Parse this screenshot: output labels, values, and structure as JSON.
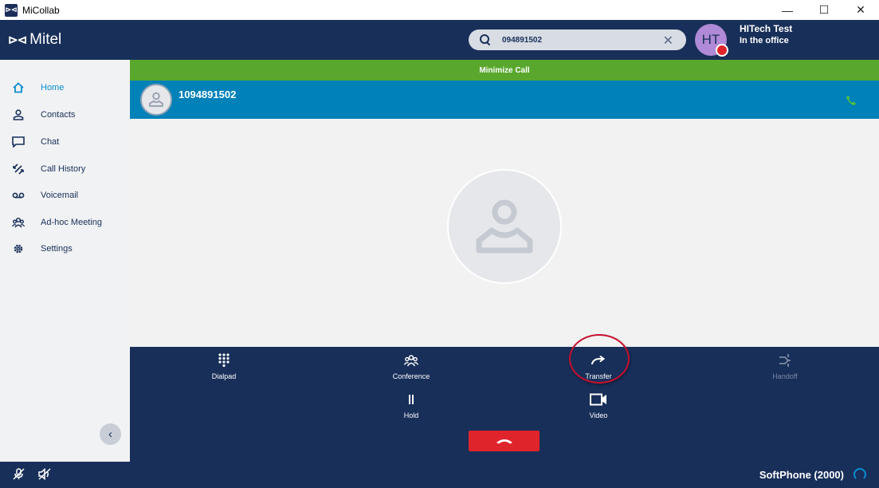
{
  "window": {
    "title": "MiCollab",
    "app_icon": "micollab-logo-icon",
    "controls": [
      "minimize-icon",
      "maximize-icon",
      "close-icon"
    ]
  },
  "header": {
    "logo_text": "Mitel",
    "search": {
      "value": "094891502",
      "placeholder": ""
    },
    "user": {
      "initials": "HT",
      "name": "HITech Test",
      "status": "In the office",
      "presence_color": "#e0242b"
    }
  },
  "sidebar": {
    "items": [
      {
        "label": "Home",
        "icon": "home-icon",
        "active": true
      },
      {
        "label": "Contacts",
        "icon": "contact-icon",
        "active": false
      },
      {
        "label": "Chat",
        "icon": "chat-icon",
        "active": false
      },
      {
        "label": "Call History",
        "icon": "call-history-icon",
        "active": false
      },
      {
        "label": "Voicemail",
        "icon": "voicemail-icon",
        "active": false
      },
      {
        "label": "Ad-hoc Meeting",
        "icon": "meeting-icon",
        "active": false
      },
      {
        "label": "Settings",
        "icon": "gear-icon",
        "active": false
      }
    ]
  },
  "call": {
    "minimize_label": "Minimize Call",
    "number": "1094891502",
    "controls": {
      "dialpad": "Dialpad",
      "conference": "Conference",
      "transfer": "Transfer",
      "handoff": "Handoff",
      "hold": "Hold",
      "video": "Video"
    }
  },
  "footer": {
    "device": "SoftPhone (2000)"
  },
  "colors": {
    "navy": "#182f59",
    "accent_blue": "#0a8ed1",
    "call_bar": "#0081b8",
    "minimize_green": "#5aa72e",
    "end_call_red": "#e0242b"
  }
}
